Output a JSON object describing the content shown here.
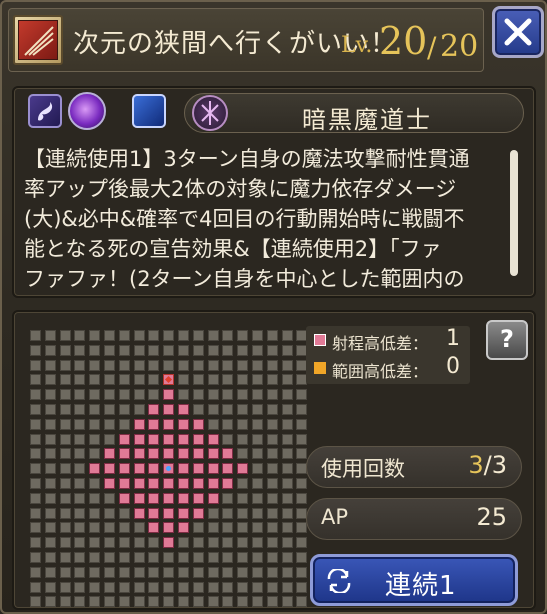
{
  "header": {
    "skill_name": "次元の狭間へ行くがいい！",
    "lv_prefix": "Lv.",
    "lv_current": "20",
    "lv_separator": "/",
    "lv_max": "20"
  },
  "icons": {
    "skill_type": "skill-category-icon",
    "close": "close-icon",
    "element_1": "dark-element-icon",
    "element_2": "purple-orb-icon",
    "element_3": "crescent-moon-icon",
    "job_crest": "job-crest-icon",
    "help": "help-icon",
    "chain": "rotate-icon"
  },
  "job": {
    "name": "暗黒魔道士"
  },
  "description": {
    "lines": [
      "【連続使用1】3ターン自身の魔法攻撃耐性貫通",
      "率アップ後最大2体の対象に魔力依存ダメージ",
      "(大)&必中&確率で4回目の行動開始時に戦闘不",
      "能となる死の宣告効果&【連続使用2】「ファ",
      "ファファ！(2ターン自身を中心とした範囲内の"
    ]
  },
  "legend": {
    "range_height_label": "射程高低差：",
    "range_height_value": "1",
    "area_height_label": "範囲高低差：",
    "area_height_value": "0",
    "range_color": "#e07a96",
    "area_color": "#f0a628"
  },
  "help_label": "?",
  "stats": {
    "uses_label": "使用回数",
    "uses_current": "3",
    "uses_sep": "/",
    "uses_max": "3",
    "ap_label": "AP",
    "ap_value": "25"
  },
  "chain_button": {
    "label": "連続1"
  },
  "colors": {
    "accent_gold": "#e6c45a",
    "button_blue": "#2a4aa8",
    "range_pink": "#e07a96"
  }
}
